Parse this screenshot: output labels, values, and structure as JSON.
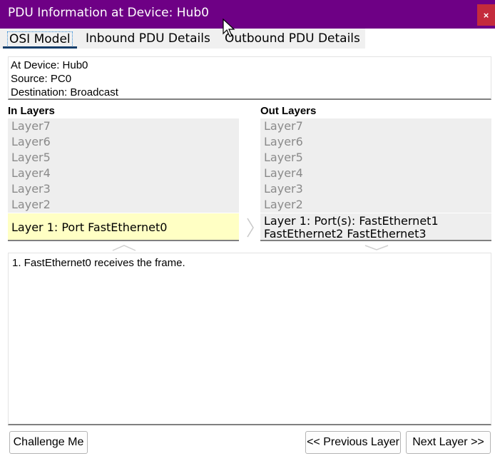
{
  "window": {
    "title": "PDU Information at Device: Hub0",
    "close_label": "×"
  },
  "tabs": [
    {
      "label": "OSI Model",
      "selected": true
    },
    {
      "label": "Inbound PDU Details",
      "selected": false
    },
    {
      "label": "Outbound PDU Details",
      "selected": false
    }
  ],
  "info": {
    "device": "At Device: Hub0",
    "source": "Source: PC0",
    "destination": "Destination: Broadcast"
  },
  "in_layers": {
    "heading": "In Layers",
    "layers": [
      "Layer7",
      "Layer6",
      "Layer5",
      "Layer4",
      "Layer3",
      "Layer2"
    ],
    "layer1": "Layer 1: Port FastEthernet0"
  },
  "out_layers": {
    "heading": "Out Layers",
    "layers": [
      "Layer7",
      "Layer6",
      "Layer5",
      "Layer4",
      "Layer3",
      "Layer2"
    ],
    "layer1_line1": "Layer 1: Port(s): FastEthernet1",
    "layer1_line2": "FastEthernet2 FastEthernet3"
  },
  "description": {
    "lines": [
      "1. FastEthernet0 receives the frame."
    ]
  },
  "buttons": {
    "challenge": "Challenge Me",
    "previous": "<< Previous Layer",
    "next": "Next Layer >>"
  },
  "colors": {
    "titlebar": "#6e0085",
    "close": "#c42b3c",
    "active_layer": "#ffffc4"
  }
}
